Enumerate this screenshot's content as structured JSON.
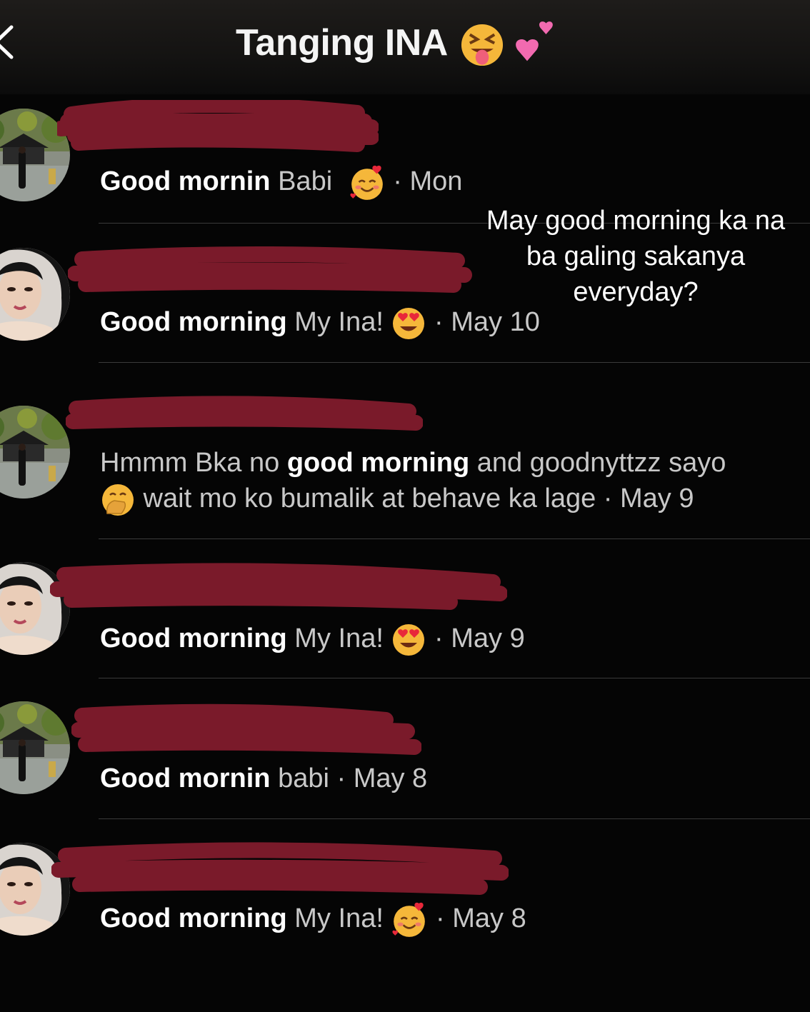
{
  "header": {
    "title": "Tanging INA",
    "emoji_1": "squinting-tongue-face",
    "emoji_2": "two-hearts"
  },
  "overlay": {
    "line1": "May good morning ka na",
    "line2": "ba galing sakanya",
    "line3": "everyday?"
  },
  "messages": [
    {
      "bold": "Good mornin",
      "text": " Babi",
      "emoji": "smiling-face-with-hearts",
      "time": " · Mon",
      "avatar": "garden-photo"
    },
    {
      "bold": "Good morning",
      "text": " My Ina!",
      "emoji": "heart-eyes",
      "time": " · May 10",
      "avatar": "woman-portrait"
    },
    {
      "text_a": "Hmmm Bka no ",
      "bold": "good morning",
      "text_b": " and goodnyttzz sayo",
      "emoji": "hand-over-mouth",
      "text_c": " wait mo ko bumalik at behave ka lage",
      "time": " · May 9",
      "avatar": "garden-photo"
    },
    {
      "bold": "Good morning",
      "text": " My Ina!",
      "emoji": "heart-eyes",
      "time": " · May 9",
      "avatar": "woman-portrait"
    },
    {
      "bold": "Good mornin",
      "text": " babi",
      "time": " · May 8",
      "avatar": "garden-photo"
    },
    {
      "bold": "Good morning",
      "text": " My Ina!",
      "emoji": "smiling-face-with-hearts",
      "time": " · May 8",
      "avatar": "woman-portrait"
    }
  ],
  "colors": {
    "background": "#050505",
    "redaction": "#7a1a2a",
    "divider": "#3a3a3a",
    "secondary_text": "#c8c8c8"
  }
}
